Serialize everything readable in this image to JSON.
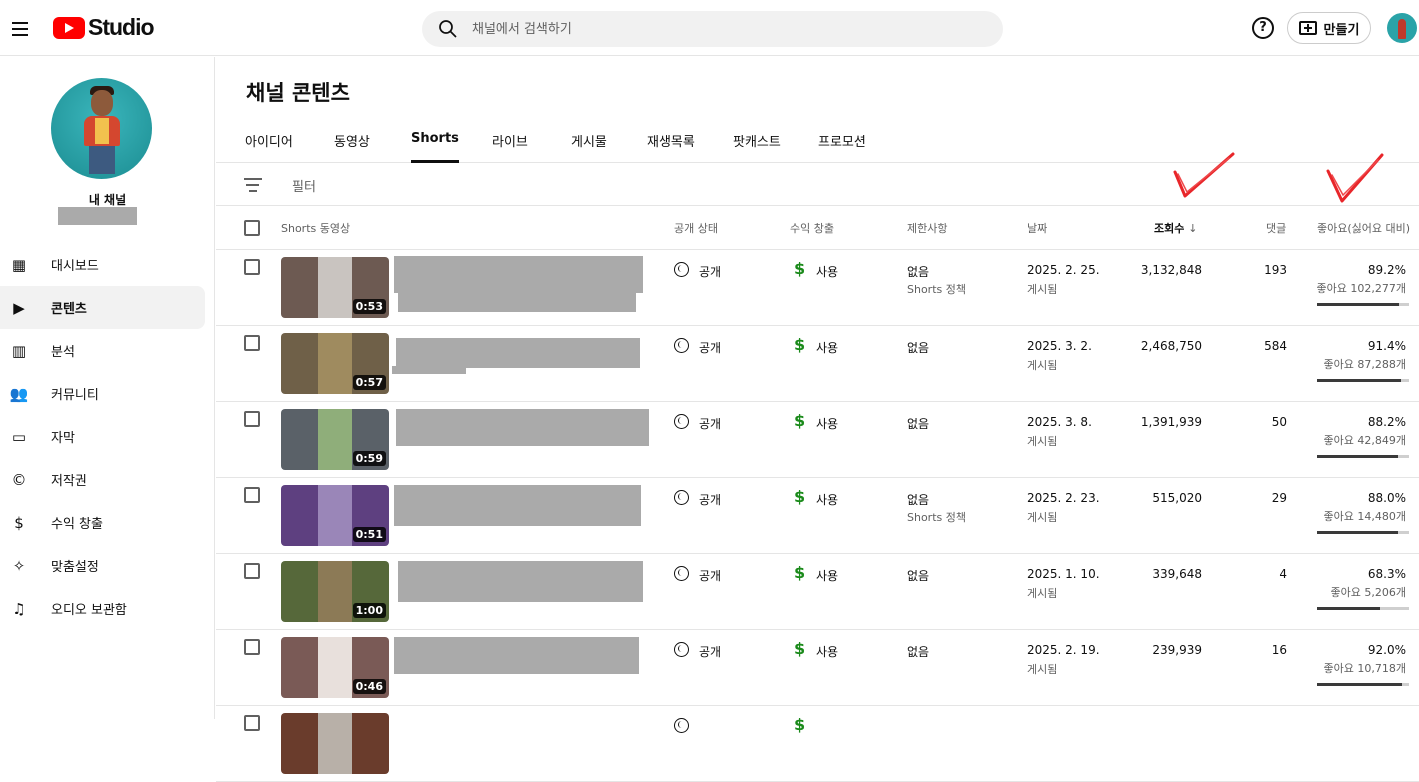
{
  "app": {
    "logo_text": "Studio"
  },
  "search": {
    "placeholder": "채널에서 검색하기"
  },
  "header": {
    "help": "?",
    "create_label": "만들기"
  },
  "sidebar": {
    "channel_name": "내 채널",
    "items": [
      {
        "label": "대시보드",
        "icon": "dashboard-icon"
      },
      {
        "label": "콘텐츠",
        "icon": "content-icon",
        "active": true
      },
      {
        "label": "분석",
        "icon": "analytics-icon"
      },
      {
        "label": "커뮤니티",
        "icon": "community-icon"
      },
      {
        "label": "자막",
        "icon": "subtitles-icon"
      },
      {
        "label": "저작권",
        "icon": "copyright-icon"
      },
      {
        "label": "수익 창출",
        "icon": "monetization-icon"
      },
      {
        "label": "맞춤설정",
        "icon": "customization-icon"
      },
      {
        "label": "오디오 보관함",
        "icon": "audio-library-icon"
      }
    ]
  },
  "main": {
    "title": "채널 콘텐츠",
    "tabs": [
      "아이디어",
      "동영상",
      "Shorts",
      "라이브",
      "게시물",
      "재생목록",
      "팟캐스트",
      "프로모션"
    ],
    "active_tab": "Shorts",
    "filter_label": "필터",
    "columns": {
      "video": "Shorts 동영상",
      "visibility": "공개 상태",
      "monetization": "수익 창출",
      "restrictions": "제한사항",
      "date": "날짜",
      "views": "조회수",
      "comments": "댓글",
      "likes": "좋아요(싫어요 대비)"
    },
    "rows": [
      {
        "duration": "0:53",
        "visibility": "공개",
        "monetization": "사용",
        "restriction": "없음",
        "restriction_sub": "Shorts 정책",
        "date": "2025. 2. 25.",
        "date_sub": "게시됨",
        "views": "3,132,848",
        "comments": "193",
        "like_pct": "89.2%",
        "like_count": "좋아요 102,277개",
        "like_ratio": 0.892,
        "thumb_color": "#6d5a52",
        "thumb_center": "#c9c4c0"
      },
      {
        "duration": "0:57",
        "visibility": "공개",
        "monetization": "사용",
        "restriction": "없음",
        "restriction_sub": "",
        "date": "2025. 3. 2.",
        "date_sub": "게시됨",
        "views": "2,468,750",
        "comments": "584",
        "like_pct": "91.4%",
        "like_count": "좋아요 87,288개",
        "like_ratio": 0.914,
        "thumb_color": "#6f6048",
        "thumb_center": "#9f8b5f"
      },
      {
        "duration": "0:59",
        "visibility": "공개",
        "monetization": "사용",
        "restriction": "없음",
        "restriction_sub": "",
        "date": "2025. 3. 8.",
        "date_sub": "게시됨",
        "views": "1,391,939",
        "comments": "50",
        "like_pct": "88.2%",
        "like_count": "좋아요 42,849개",
        "like_ratio": 0.882,
        "thumb_color": "#5a6168",
        "thumb_center": "#8fae7a"
      },
      {
        "duration": "0:51",
        "visibility": "공개",
        "monetization": "사용",
        "restriction": "없음",
        "restriction_sub": "Shorts 정책",
        "date": "2025. 2. 23.",
        "date_sub": "게시됨",
        "views": "515,020",
        "comments": "29",
        "like_pct": "88.0%",
        "like_count": "좋아요 14,480개",
        "like_ratio": 0.88,
        "thumb_color": "#5e4080",
        "thumb_center": "#9a86b8"
      },
      {
        "duration": "1:00",
        "visibility": "공개",
        "monetization": "사용",
        "restriction": "없음",
        "restriction_sub": "",
        "date": "2025. 1. 10.",
        "date_sub": "게시됨",
        "views": "339,648",
        "comments": "4",
        "like_pct": "68.3%",
        "like_count": "좋아요 5,206개",
        "like_ratio": 0.683,
        "thumb_color": "#56683a",
        "thumb_center": "#8c7a56"
      },
      {
        "duration": "0:46",
        "visibility": "공개",
        "monetization": "사용",
        "restriction": "없음",
        "restriction_sub": "",
        "date": "2025. 2. 19.",
        "date_sub": "게시됨",
        "views": "239,939",
        "comments": "16",
        "like_pct": "92.0%",
        "like_count": "좋아요 10,718개",
        "like_ratio": 0.92,
        "thumb_color": "#7a5a56",
        "thumb_center": "#e8e0dc"
      },
      {
        "duration": "",
        "visibility": "",
        "monetization": "",
        "restriction": "",
        "restriction_sub": "",
        "date": "",
        "date_sub": "",
        "views": "",
        "comments": "",
        "like_pct": "",
        "like_count": "",
        "like_ratio": 0,
        "thumb_color": "#6a3c2c",
        "thumb_center": "#b8b0a8"
      }
    ]
  }
}
